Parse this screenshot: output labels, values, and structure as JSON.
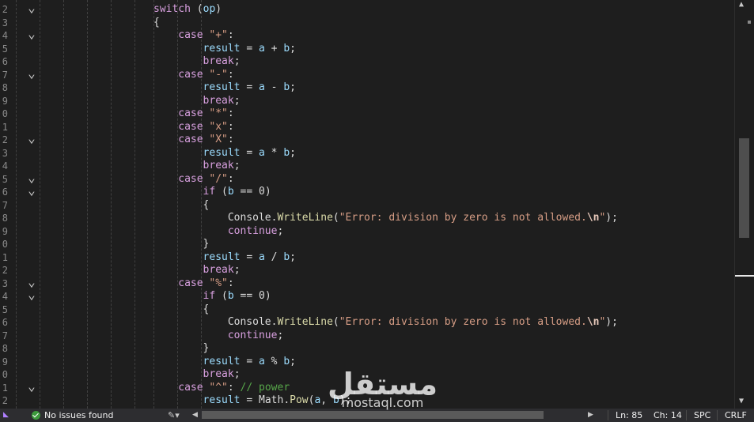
{
  "editor": {
    "lines": [
      {
        "num": "2",
        "fold": true
      },
      {
        "num": "3",
        "fold": false
      },
      {
        "num": "4",
        "fold": true
      },
      {
        "num": "5",
        "fold": false
      },
      {
        "num": "6",
        "fold": false
      },
      {
        "num": "7",
        "fold": true
      },
      {
        "num": "8",
        "fold": false
      },
      {
        "num": "9",
        "fold": false
      },
      {
        "num": "0",
        "fold": false
      },
      {
        "num": "1",
        "fold": false
      },
      {
        "num": "2",
        "fold": true
      },
      {
        "num": "3",
        "fold": false
      },
      {
        "num": "4",
        "fold": false
      },
      {
        "num": "5",
        "fold": true
      },
      {
        "num": "6",
        "fold": true
      },
      {
        "num": "7",
        "fold": false
      },
      {
        "num": "8",
        "fold": false
      },
      {
        "num": "9",
        "fold": false
      },
      {
        "num": "0",
        "fold": false
      },
      {
        "num": "1",
        "fold": false
      },
      {
        "num": "2",
        "fold": false
      },
      {
        "num": "3",
        "fold": true
      },
      {
        "num": "4",
        "fold": true
      },
      {
        "num": "5",
        "fold": false
      },
      {
        "num": "6",
        "fold": false
      },
      {
        "num": "7",
        "fold": false
      },
      {
        "num": "8",
        "fold": false
      },
      {
        "num": "9",
        "fold": false
      },
      {
        "num": "0",
        "fold": false
      },
      {
        "num": "1",
        "fold": true
      },
      {
        "num": "2",
        "fold": false
      }
    ],
    "code": [
      {
        "indent": 0,
        "tokens": [
          [
            "ctl",
            "switch"
          ],
          [
            "p",
            " ("
          ],
          [
            "var",
            "op"
          ],
          [
            "p",
            ")"
          ]
        ]
      },
      {
        "indent": 0,
        "tokens": [
          [
            "p",
            "{"
          ]
        ]
      },
      {
        "indent": 1,
        "tokens": [
          [
            "ctl",
            "case"
          ],
          [
            "p",
            " "
          ],
          [
            "str",
            "\"+\""
          ],
          [
            "p",
            ":"
          ]
        ]
      },
      {
        "indent": 2,
        "tokens": [
          [
            "var",
            "result"
          ],
          [
            "p",
            " = "
          ],
          [
            "var",
            "a"
          ],
          [
            "p",
            " + "
          ],
          [
            "var",
            "b"
          ],
          [
            "p",
            ";"
          ]
        ]
      },
      {
        "indent": 2,
        "tokens": [
          [
            "ctl",
            "break"
          ],
          [
            "p",
            ";"
          ]
        ]
      },
      {
        "indent": 1,
        "tokens": [
          [
            "ctl",
            "case"
          ],
          [
            "p",
            " "
          ],
          [
            "str",
            "\"-\""
          ],
          [
            "p",
            ":"
          ]
        ]
      },
      {
        "indent": 2,
        "tokens": [
          [
            "var",
            "result"
          ],
          [
            "p",
            " = "
          ],
          [
            "var",
            "a"
          ],
          [
            "p",
            " - "
          ],
          [
            "var",
            "b"
          ],
          [
            "p",
            ";"
          ]
        ]
      },
      {
        "indent": 2,
        "tokens": [
          [
            "ctl",
            "break"
          ],
          [
            "p",
            ";"
          ]
        ]
      },
      {
        "indent": 1,
        "tokens": [
          [
            "ctl",
            "case"
          ],
          [
            "p",
            " "
          ],
          [
            "str",
            "\"*\""
          ],
          [
            "p",
            ":"
          ]
        ]
      },
      {
        "indent": 1,
        "tokens": [
          [
            "ctl",
            "case"
          ],
          [
            "p",
            " "
          ],
          [
            "str",
            "\"x\""
          ],
          [
            "p",
            ":"
          ]
        ]
      },
      {
        "indent": 1,
        "tokens": [
          [
            "ctl",
            "case"
          ],
          [
            "p",
            " "
          ],
          [
            "str",
            "\"X\""
          ],
          [
            "p",
            ":"
          ]
        ]
      },
      {
        "indent": 2,
        "tokens": [
          [
            "var",
            "result"
          ],
          [
            "p",
            " = "
          ],
          [
            "var",
            "a"
          ],
          [
            "p",
            " * "
          ],
          [
            "var",
            "b"
          ],
          [
            "p",
            ";"
          ]
        ]
      },
      {
        "indent": 2,
        "tokens": [
          [
            "ctl",
            "break"
          ],
          [
            "p",
            ";"
          ]
        ]
      },
      {
        "indent": 1,
        "tokens": [
          [
            "ctl",
            "case"
          ],
          [
            "p",
            " "
          ],
          [
            "str",
            "\"/\""
          ],
          [
            "p",
            ":"
          ]
        ]
      },
      {
        "indent": 2,
        "tokens": [
          [
            "ctl",
            "if"
          ],
          [
            "p",
            " ("
          ],
          [
            "var",
            "b"
          ],
          [
            "p",
            " == 0)"
          ]
        ]
      },
      {
        "indent": 2,
        "tokens": [
          [
            "p",
            "{"
          ]
        ]
      },
      {
        "indent": 3,
        "tokens": [
          [
            "type",
            "Console"
          ],
          [
            "p",
            "."
          ],
          [
            "method",
            "WriteLine"
          ],
          [
            "p",
            "("
          ],
          [
            "str",
            "\"Error: division by zero is not allowed."
          ],
          [
            "esc",
            "\\n"
          ],
          [
            "str",
            "\""
          ],
          [
            "p",
            ");"
          ]
        ]
      },
      {
        "indent": 3,
        "tokens": [
          [
            "ctl",
            "continue"
          ],
          [
            "p",
            ";"
          ]
        ]
      },
      {
        "indent": 2,
        "tokens": [
          [
            "p",
            "}"
          ]
        ]
      },
      {
        "indent": 2,
        "tokens": [
          [
            "var",
            "result"
          ],
          [
            "p",
            " = "
          ],
          [
            "var",
            "a"
          ],
          [
            "p",
            " / "
          ],
          [
            "var",
            "b"
          ],
          [
            "p",
            ";"
          ]
        ]
      },
      {
        "indent": 2,
        "tokens": [
          [
            "ctl",
            "break"
          ],
          [
            "p",
            ";"
          ]
        ]
      },
      {
        "indent": 1,
        "tokens": [
          [
            "ctl",
            "case"
          ],
          [
            "p",
            " "
          ],
          [
            "str",
            "\"%\""
          ],
          [
            "p",
            ":"
          ]
        ]
      },
      {
        "indent": 2,
        "tokens": [
          [
            "ctl",
            "if"
          ],
          [
            "p",
            " ("
          ],
          [
            "var",
            "b"
          ],
          [
            "p",
            " == 0)"
          ]
        ]
      },
      {
        "indent": 2,
        "tokens": [
          [
            "p",
            "{"
          ]
        ]
      },
      {
        "indent": 3,
        "tokens": [
          [
            "type",
            "Console"
          ],
          [
            "p",
            "."
          ],
          [
            "method",
            "WriteLine"
          ],
          [
            "p",
            "("
          ],
          [
            "str",
            "\"Error: division by zero is not allowed."
          ],
          [
            "esc",
            "\\n"
          ],
          [
            "str",
            "\""
          ],
          [
            "p",
            ");"
          ]
        ]
      },
      {
        "indent": 3,
        "tokens": [
          [
            "ctl",
            "continue"
          ],
          [
            "p",
            ";"
          ]
        ]
      },
      {
        "indent": 2,
        "tokens": [
          [
            "p",
            "}"
          ]
        ]
      },
      {
        "indent": 2,
        "tokens": [
          [
            "var",
            "result"
          ],
          [
            "p",
            " = "
          ],
          [
            "var",
            "a"
          ],
          [
            "p",
            " % "
          ],
          [
            "var",
            "b"
          ],
          [
            "p",
            ";"
          ]
        ]
      },
      {
        "indent": 2,
        "tokens": [
          [
            "ctl",
            "break"
          ],
          [
            "p",
            ";"
          ]
        ]
      },
      {
        "indent": 1,
        "tokens": [
          [
            "ctl",
            "case"
          ],
          [
            "p",
            " "
          ],
          [
            "str",
            "\"^\""
          ],
          [
            "p",
            ": "
          ],
          [
            "cmt",
            "// power"
          ]
        ]
      },
      {
        "indent": 2,
        "tokens": [
          [
            "var",
            "result"
          ],
          [
            "p",
            " = "
          ],
          [
            "type",
            "Math"
          ],
          [
            "p",
            "."
          ],
          [
            "method",
            "Pow"
          ],
          [
            "p",
            "("
          ],
          [
            "var",
            "a"
          ],
          [
            "p",
            ", "
          ],
          [
            "var",
            "b"
          ],
          [
            "p",
            ");"
          ]
        ]
      }
    ]
  },
  "status": {
    "issues": "No issues found",
    "line": "Ln: 85",
    "col": "Ch: 14",
    "spacing": "SPC",
    "line_ending": "CRLF"
  },
  "watermark": {
    "arabic": "مستقل",
    "latin": "mostaql.com"
  },
  "icons": {
    "fold": "chevron-down-icon",
    "ok": "check-circle-icon",
    "cleanup": "brush-icon"
  }
}
